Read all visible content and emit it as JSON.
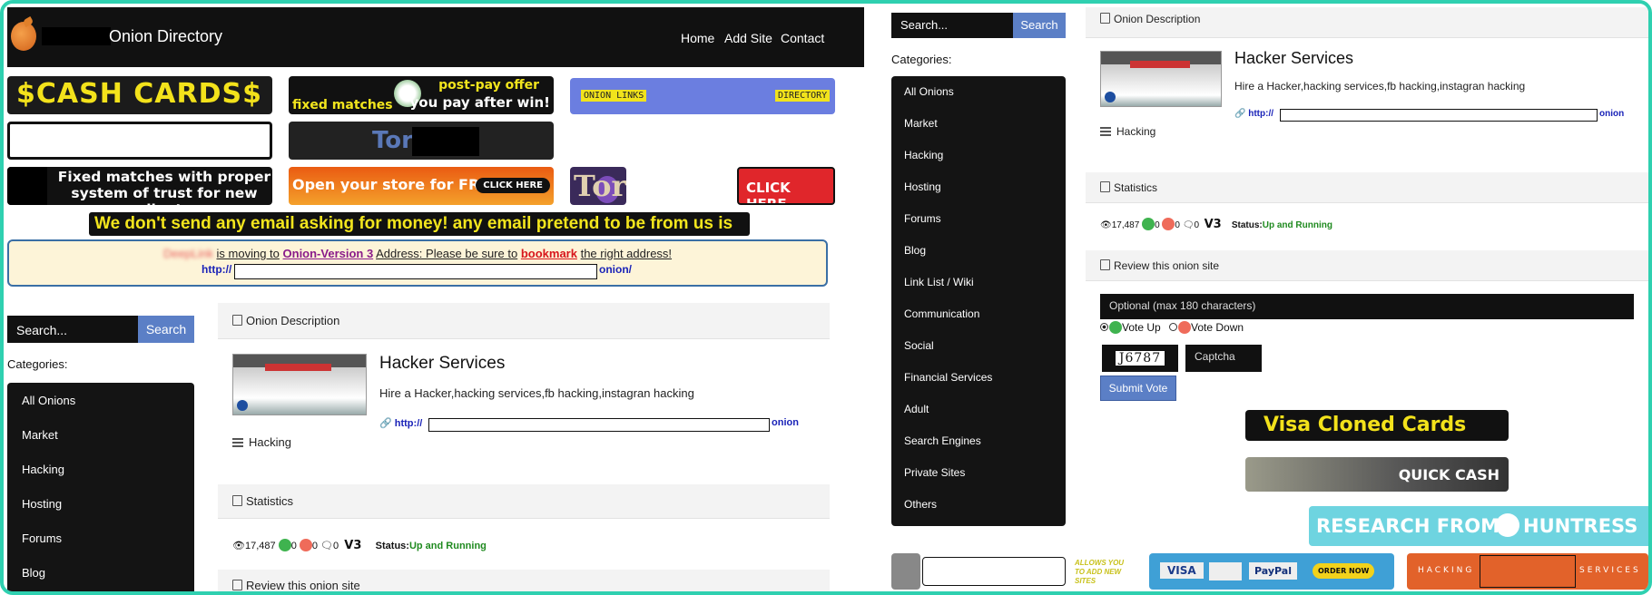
{
  "nav": {
    "brand": "Onion Directory",
    "links": [
      "Home",
      "Add Site",
      "Contact"
    ]
  },
  "banners": {
    "cash_cards": "$CASH CARDS$",
    "post_pay_1": "post-pay offer",
    "post_pay_2": "you pay after win!",
    "post_pay_3": "fixed matches",
    "onion_links_1": "ONION LINKS",
    "onion_links_2": "DIRECTORY",
    "tor": "Tor",
    "fixed_matches": "Fixed matches with proper system of trust for new clients",
    "store": "Open your store for FREE",
    "store_cta": "CLICK HERE",
    "tor_logo": "Tor",
    "click_here": "CLICK HERE",
    "scam_warning": "We don't send any email asking for money! any email pretend to be from us is SCAM !"
  },
  "notice": {
    "blurred_name": "DeepLink",
    "text_1": "is moving to",
    "version": "Onion-Version 3",
    "text_2": "Address: Please be sure to",
    "bookmark": "bookmark",
    "text_3": "the right address!",
    "url_prefix": "http://",
    "url_suffix": "onion/"
  },
  "search": {
    "placeholder": "Search...",
    "button": "Search"
  },
  "categories_label": "Categories:",
  "categories": [
    "All Onions",
    "Market",
    "Hacking",
    "Hosting",
    "Forums",
    "Blog",
    "Link List / Wiki",
    "Communication",
    "Social",
    "Financial Services",
    "Adult",
    "Search Engines",
    "Private Sites",
    "Others"
  ],
  "listing": {
    "section_title": "Onion Description",
    "title": "Hacker Services",
    "description": "Hire a Hacker,hacking services,fb hacking,instagran hacking",
    "url_prefix": "http://",
    "url_suffix": "onion",
    "category": "Hacking"
  },
  "statistics": {
    "section_title": "Statistics",
    "views": "17,487",
    "votes_up": "0",
    "votes_down": "0",
    "comments": "0",
    "version": "V3",
    "status_label": "Status:",
    "status_value": "Up and Running"
  },
  "review": {
    "section_title": "Review this onion site",
    "comment_placeholder": "Optional (max 180 characters)",
    "vote_up": "Vote Up",
    "vote_down": "Vote Down",
    "captcha_text": "J6787",
    "captcha_placeholder": "Captcha",
    "submit": "Submit Vote"
  },
  "ads": {
    "visa_cloned": "Visa Cloned Cards",
    "quick_cash": "QUICK CASH",
    "research": "RESEARCH FROM",
    "huntress": "HUNTRESS",
    "allows": "ALLOWS YOU TO ADD NEW SITES",
    "visa": "VISA",
    "paypal": "PayPal",
    "order_now": "ORDER NOW",
    "hacking": "HACKING",
    "services": "SERVICES"
  },
  "colors": {
    "accent": "#5b7fc6",
    "frame": "#2fd0b0",
    "status_ok": "#1f8a1f",
    "link": "#1a23b8"
  }
}
